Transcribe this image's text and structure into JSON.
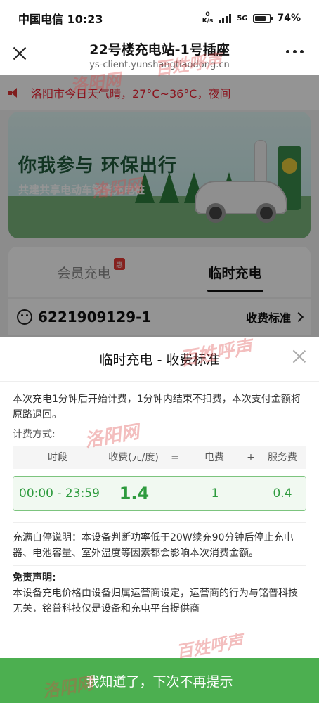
{
  "status_bar": {
    "carrier_time": "中国电信 10:23",
    "net_speed_value": "0",
    "net_speed_unit": "K/s",
    "network": "5G",
    "battery_percent": "74%",
    "battery_level": 0.74
  },
  "header": {
    "title": "22号楼充电站-1号插座",
    "url": "ys-client.yunshangtiaodong.cn"
  },
  "background_page": {
    "notice": "洛阳市今日天气晴，27°C~36°C，夜间",
    "banner_slogan": "你我参与 环保出行",
    "banner_sub": "共建共享电动车智能充电桩",
    "tabs": [
      {
        "label": "会员充电",
        "badge": "惠"
      },
      {
        "label": "临时充电"
      }
    ],
    "device_id": "6221909129-1",
    "fee_link": "收费标准"
  },
  "sheet": {
    "title": "临时充电 - 收费标准",
    "intro": "本次充电1分钟后开始计费，1分钟内结束不扣费，本次支付金额将原路退回。",
    "method_label": "计费方式:",
    "table": {
      "headers": [
        "时段",
        "收费(元/度)",
        "=",
        "电费",
        "+",
        "服务费"
      ],
      "rows": [
        {
          "period": "00:00 - 23:59",
          "price": "1.4",
          "electricity": "1",
          "service": "0.4"
        }
      ]
    },
    "auto_stop": "充满自停说明：本设备判断功率低于20W续充90分钟后停止充电器、电池容量、室外温度等因素都会影响本次消费金额。",
    "disclaimer_title": "免责声明:",
    "disclaimer": "本设备充电价格由设备归属运营商设定，运营商的行为与铭普科技无关，铭普科技仅是设备和充电平台提供商",
    "confirm_button": "我知道了，下次不再提示"
  },
  "watermarks": [
    "洛阳网",
    "百姓呼声"
  ],
  "colors": {
    "accent_green": "#4caf50",
    "price_green": "#2e9b3e",
    "notice_red": "#e22233"
  }
}
